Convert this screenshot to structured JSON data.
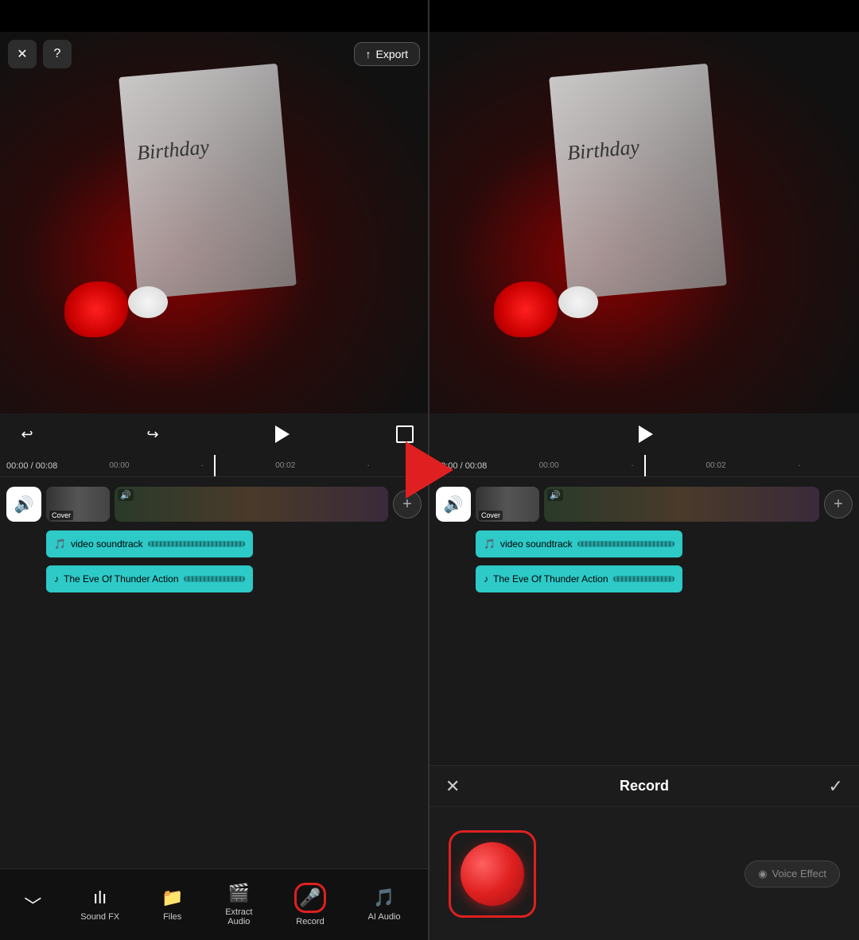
{
  "left_panel": {
    "header": {
      "close_label": "✕",
      "help_label": "?",
      "export_icon": "↑",
      "export_label": "Export"
    },
    "playback": {
      "undo_icon": "↩",
      "redo_icon": "↪",
      "play_title": "Play",
      "fullscreen_title": "Fullscreen"
    },
    "timeline": {
      "current_time": "00:00",
      "total_time": "00:08",
      "mark1": "00:00",
      "mark2": "00:02"
    },
    "tracks": {
      "audio_icon": "🔊",
      "cover_label": "Cover",
      "add_icon": "+",
      "soundtrack_label": "video soundtrack",
      "thunder_label": "The Eve Of Thunder Action",
      "music_icon": "♪",
      "video_icon": "⊡"
    },
    "toolbar": {
      "back_icon": "﹀",
      "items": [
        {
          "id": "sound-fx",
          "icon": "📊",
          "label": "Sound FX",
          "unicode": "ılı"
        },
        {
          "id": "files",
          "icon": "📁",
          "label": "Files"
        },
        {
          "id": "extract-audio",
          "icon": "🎬",
          "label": "Extract\nAudio"
        },
        {
          "id": "record",
          "icon": "🎤",
          "label": "Record",
          "active": true
        },
        {
          "id": "ai-audio",
          "icon": "🎵",
          "label": "AI Audio"
        }
      ]
    }
  },
  "right_panel": {
    "timeline": {
      "current_time": "00:00",
      "total_time": "00:08",
      "mark1": "00:00",
      "mark2": "00:02"
    },
    "tracks": {
      "audio_icon": "🔊",
      "cover_label": "Cover",
      "add_icon": "+",
      "soundtrack_label": "video soundtrack",
      "thunder_label": "The Eve Of Thunder Action",
      "music_icon": "♪"
    },
    "record": {
      "close_icon": "✕",
      "title": "Record",
      "check_icon": "✓",
      "voice_effect_icon": "◉",
      "voice_effect_label": "Voice Effect"
    }
  },
  "arrow": {
    "direction": "right"
  }
}
